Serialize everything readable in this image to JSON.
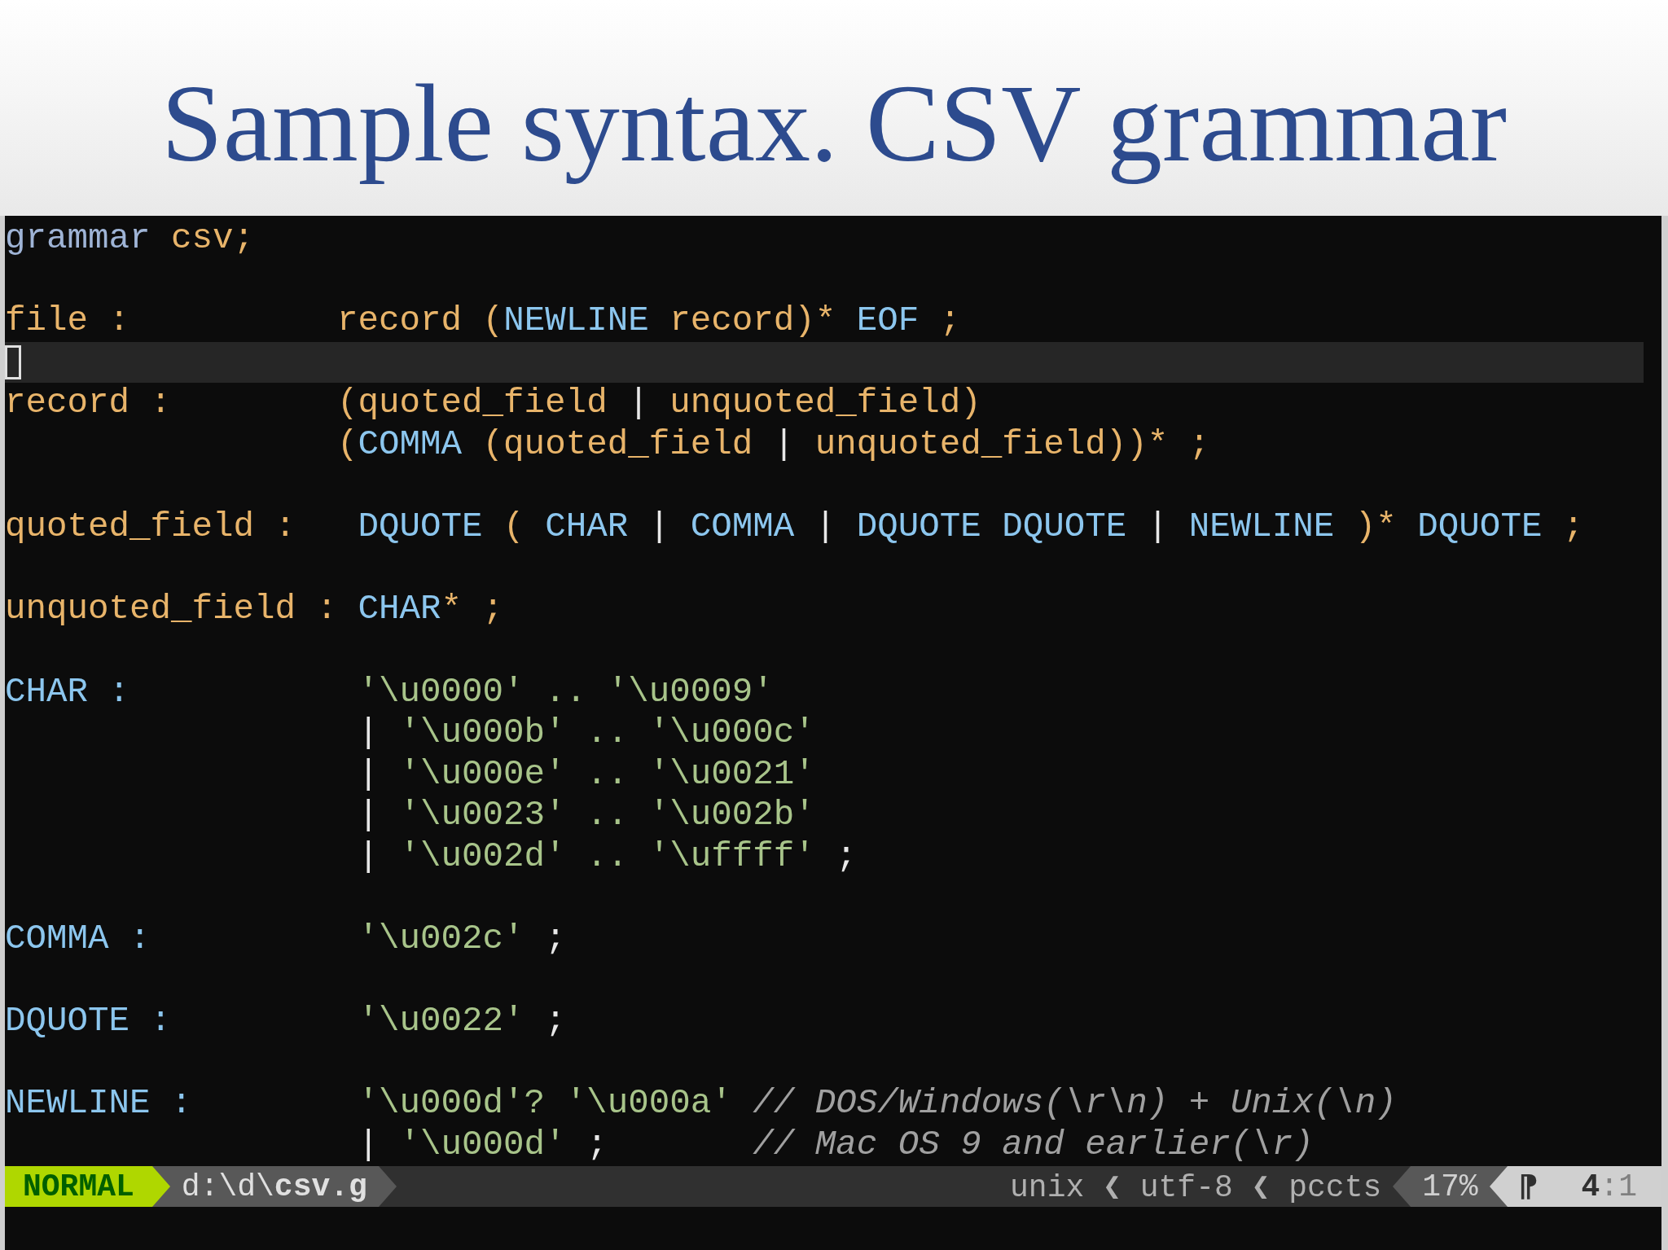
{
  "slide": {
    "title": "Sample syntax. CSV grammar"
  },
  "editor": {
    "lines": [
      {
        "current": false,
        "tokens": [
          {
            "text": "grammar ",
            "kind": "keyword"
          },
          {
            "text": "csv;",
            "kind": "rule"
          }
        ]
      },
      {
        "current": false
      },
      {
        "current": false,
        "tokens": [
          {
            "text": "file :          ",
            "kind": "rule"
          },
          {
            "text": "record (",
            "kind": "rule"
          },
          {
            "text": "NEWLINE",
            "kind": "token"
          },
          {
            "text": " record)* ",
            "kind": "rule"
          },
          {
            "text": "EOF",
            "kind": "token"
          },
          {
            "text": " ;",
            "kind": "rule"
          }
        ]
      },
      {
        "current": true
      },
      {
        "current": false,
        "tokens": [
          {
            "text": "record :        ",
            "kind": "rule"
          },
          {
            "text": "(quoted_field ",
            "kind": "rule"
          },
          {
            "text": "|",
            "kind": "plain"
          },
          {
            "text": " unquoted_field)",
            "kind": "rule"
          }
        ]
      },
      {
        "current": false,
        "tokens": [
          {
            "text": "                (",
            "kind": "rule"
          },
          {
            "text": "COMMA",
            "kind": "token"
          },
          {
            "text": " (quoted_field ",
            "kind": "rule"
          },
          {
            "text": "|",
            "kind": "plain"
          },
          {
            "text": " unquoted_field))* ;",
            "kind": "rule"
          }
        ]
      },
      {
        "current": false
      },
      {
        "current": false,
        "tokens": [
          {
            "text": "quoted_field :   ",
            "kind": "rule"
          },
          {
            "text": "DQUOTE",
            "kind": "token"
          },
          {
            "text": " ( ",
            "kind": "rule"
          },
          {
            "text": "CHAR",
            "kind": "token"
          },
          {
            "text": " | ",
            "kind": "plain"
          },
          {
            "text": "COMMA",
            "kind": "token"
          },
          {
            "text": " | ",
            "kind": "plain"
          },
          {
            "text": "DQUOTE DQUOTE",
            "kind": "token"
          },
          {
            "text": " | ",
            "kind": "plain"
          },
          {
            "text": "NEWLINE",
            "kind": "token"
          },
          {
            "text": " )* ",
            "kind": "rule"
          },
          {
            "text": "DQUOTE",
            "kind": "token"
          },
          {
            "text": " ;",
            "kind": "rule"
          }
        ]
      },
      {
        "current": false
      },
      {
        "current": false,
        "tokens": [
          {
            "text": "unquoted_field : ",
            "kind": "rule"
          },
          {
            "text": "CHAR",
            "kind": "token"
          },
          {
            "text": "* ;",
            "kind": "rule"
          }
        ]
      },
      {
        "current": false
      },
      {
        "current": false,
        "tokens": [
          {
            "text": "CHAR :           ",
            "kind": "token"
          },
          {
            "text": "'\\u0000' .. '\\u0009'",
            "kind": "string"
          }
        ]
      },
      {
        "current": false,
        "tokens": [
          {
            "text": "                 |",
            "kind": "plain"
          },
          {
            "text": " '\\u000b' .. '\\u000c'",
            "kind": "string"
          }
        ]
      },
      {
        "current": false,
        "tokens": [
          {
            "text": "                 |",
            "kind": "plain"
          },
          {
            "text": " '\\u000e' .. '\\u0021'",
            "kind": "string"
          }
        ]
      },
      {
        "current": false,
        "tokens": [
          {
            "text": "                 |",
            "kind": "plain"
          },
          {
            "text": " '\\u0023' .. '\\u002b'",
            "kind": "string"
          }
        ]
      },
      {
        "current": false,
        "tokens": [
          {
            "text": "                 |",
            "kind": "plain"
          },
          {
            "text": " '\\u002d' .. '\\uffff' ",
            "kind": "string"
          },
          {
            "text": ";",
            "kind": "plain"
          }
        ]
      },
      {
        "current": false
      },
      {
        "current": false,
        "tokens": [
          {
            "text": "COMMA :          ",
            "kind": "token"
          },
          {
            "text": "'\\u002c' ",
            "kind": "string"
          },
          {
            "text": ";",
            "kind": "plain"
          }
        ]
      },
      {
        "current": false
      },
      {
        "current": false,
        "tokens": [
          {
            "text": "DQUOTE :         ",
            "kind": "token"
          },
          {
            "text": "'\\u0022' ",
            "kind": "string"
          },
          {
            "text": ";",
            "kind": "plain"
          }
        ]
      },
      {
        "current": false
      },
      {
        "current": false,
        "tokens": [
          {
            "text": "NEWLINE :        ",
            "kind": "token"
          },
          {
            "text": "'\\u000d'? '\\u000a' ",
            "kind": "string"
          },
          {
            "text": "// DOS/Windows(\\r\\n) + Unix(\\n)",
            "kind": "comment"
          }
        ]
      },
      {
        "current": false,
        "tokens": [
          {
            "text": "                 |",
            "kind": "plain"
          },
          {
            "text": " '\\u000d' ",
            "kind": "string"
          },
          {
            "text": ";       ",
            "kind": "plain"
          },
          {
            "text": "// Mac OS 9 and earlier(\\r)",
            "kind": "comment"
          }
        ]
      }
    ]
  },
  "status_bar": {
    "mode": "NORMAL",
    "file": "d:\\d\\**csv.g**",
    "file_info": "unix ❮ utf-8 ❮ pccts",
    "percent": "17%",
    "line_symbol": "⁋",
    "position": "**4**:1"
  }
}
